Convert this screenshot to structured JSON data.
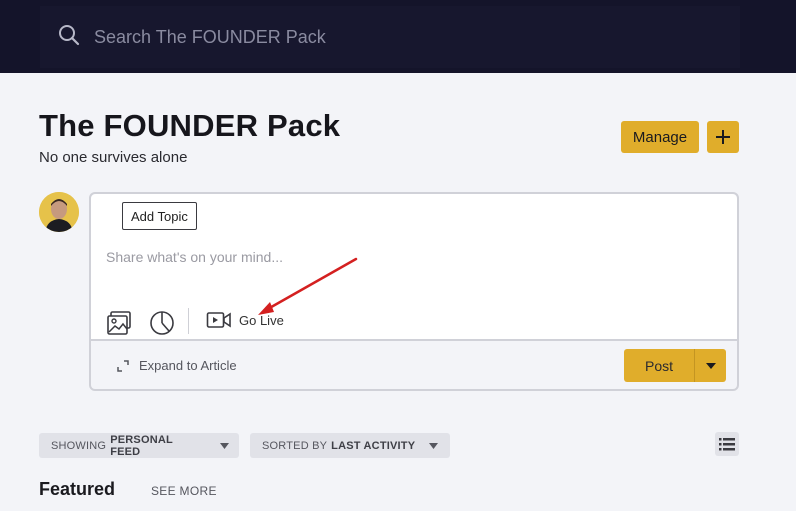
{
  "search": {
    "placeholder": "Search The FOUNDER Pack"
  },
  "group": {
    "title": "The FOUNDER Pack",
    "tagline": "No one survives alone"
  },
  "header_actions": {
    "manage_label": "Manage"
  },
  "composer": {
    "add_topic_label": "Add Topic",
    "share_placeholder": "Share what's on your mind...",
    "go_live_label": "Go Live",
    "expand_label": "Expand to Article",
    "post_label": "Post"
  },
  "filters": {
    "feed_prefix": "SHOWING",
    "feed_value": "PERSONAL FEED",
    "sort_prefix": "SORTED BY",
    "sort_value": "LAST ACTIVITY"
  },
  "featured": {
    "heading": "Featured",
    "see_more": "SEE MORE"
  },
  "colors": {
    "accent": "#e0ad2b",
    "topbar": "#14142a",
    "background": "#f3f4f8",
    "annotation_arrow": "#d42020"
  },
  "icons": [
    "search-icon",
    "plus-icon",
    "image-icon",
    "poll-icon",
    "video-icon",
    "expand-icon",
    "caret-down-icon",
    "list-view-icon"
  ]
}
